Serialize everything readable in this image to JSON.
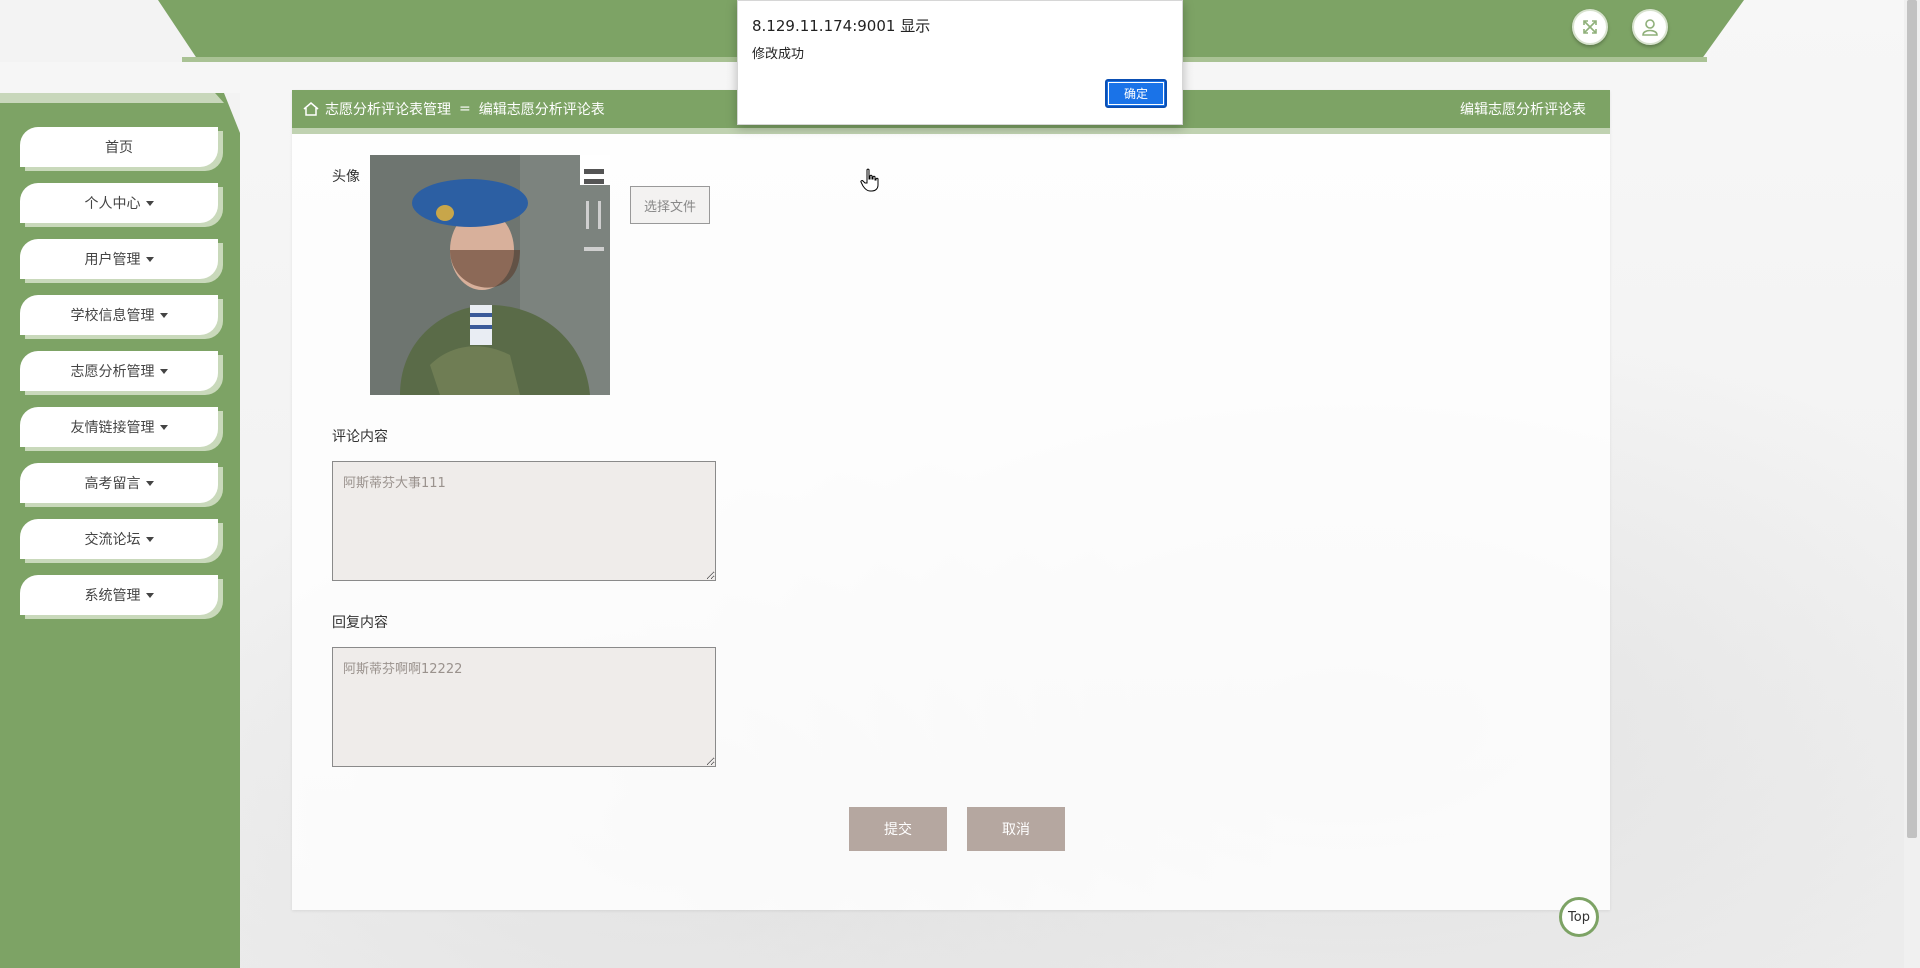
{
  "header": {
    "fullscreen_icon": "fullscreen-icon",
    "user_icon": "user-icon"
  },
  "sidebar": {
    "items": [
      {
        "label": "首页",
        "has_dropdown": false
      },
      {
        "label": "个人中心",
        "has_dropdown": true
      },
      {
        "label": "用户管理",
        "has_dropdown": true
      },
      {
        "label": "学校信息管理",
        "has_dropdown": true
      },
      {
        "label": "志愿分析管理",
        "has_dropdown": true
      },
      {
        "label": "友情链接管理",
        "has_dropdown": true
      },
      {
        "label": "高考留言",
        "has_dropdown": true
      },
      {
        "label": "交流论坛",
        "has_dropdown": true
      },
      {
        "label": "系统管理",
        "has_dropdown": true
      }
    ]
  },
  "breadcrumb": {
    "parent": "志愿分析评论表管理",
    "separator": "=",
    "current": "编辑志愿分析评论表",
    "right_title": "编辑志愿分析评论表"
  },
  "form": {
    "avatar_label": "头像",
    "file_button": "选择文件",
    "comment_label": "评论内容",
    "comment_value": "阿斯蒂芬大事111",
    "reply_label": "回复内容",
    "reply_value": "阿斯蒂芬啊啊12222",
    "submit_label": "提交",
    "cancel_label": "取消"
  },
  "top_button": "Top",
  "dialog": {
    "title": "8.129.11.174:9001 显示",
    "message": "修改成功",
    "ok_label": "确定"
  },
  "colors": {
    "brand_green": "#7da365",
    "button_taupe": "#b5a7a0",
    "dialog_blue": "#1a73e8"
  }
}
